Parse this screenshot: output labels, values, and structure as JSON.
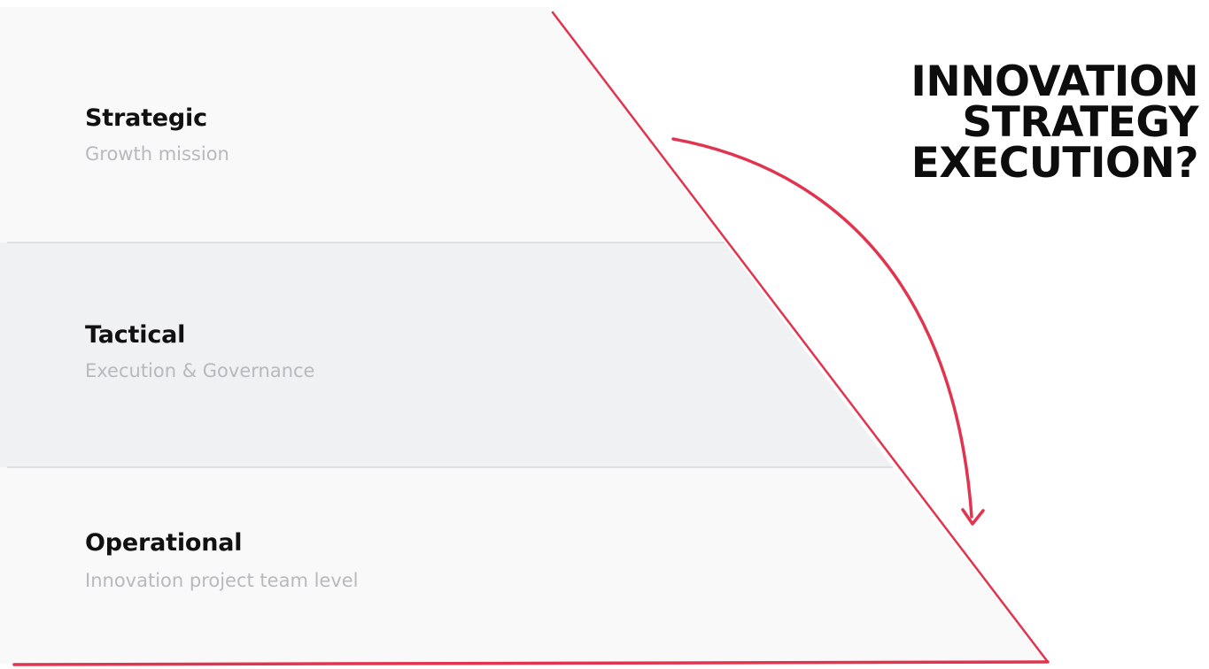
{
  "levels": [
    {
      "title": "Strategic",
      "subtitle": "Growth mission"
    },
    {
      "title": "Tactical",
      "subtitle": "Execution & Governance"
    },
    {
      "title": "Operational",
      "subtitle": "Innovation project team level"
    }
  ],
  "headline": [
    "INNOVATION",
    "STRATEGY",
    "EXECUTION?"
  ],
  "colors": {
    "accent": "#e0344f",
    "band_light": "#f9f9fa",
    "band_mid": "#f0f1f3",
    "divider": "#d8d9dc",
    "title": "#111111",
    "subtitle": "#b7b9bc"
  }
}
